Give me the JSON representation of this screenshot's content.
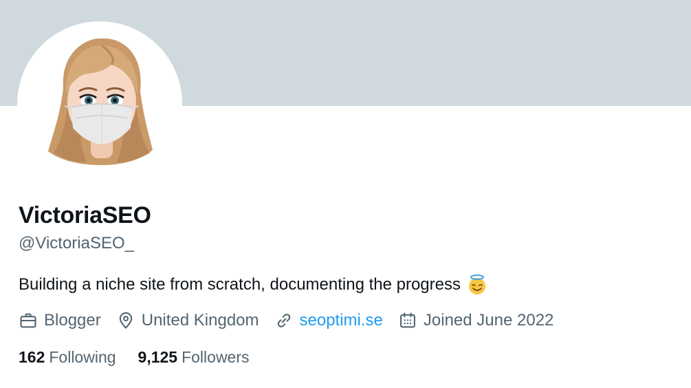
{
  "profile": {
    "display_name": "VictoriaSEO",
    "handle": "@VictoriaSEO_",
    "bio": "Building a niche site from scratch, documenting the progress",
    "bio_emoji": "smiling-face-with-halo-emoji"
  },
  "meta": {
    "category": "Blogger",
    "location": "United Kingdom",
    "website": "seoptimi.se",
    "joined": "Joined June 2022"
  },
  "counts": {
    "following_value": "162",
    "following_label": "Following",
    "followers_value": "9,125",
    "followers_label": "Followers"
  },
  "colors": {
    "banner": "#cfd9de",
    "text_primary": "#0f1419",
    "text_secondary": "#536471",
    "link": "#1d9bf0"
  },
  "icons": {
    "category": "briefcase-icon",
    "location": "location-pin-icon",
    "website": "link-icon",
    "joined": "calendar-icon"
  }
}
